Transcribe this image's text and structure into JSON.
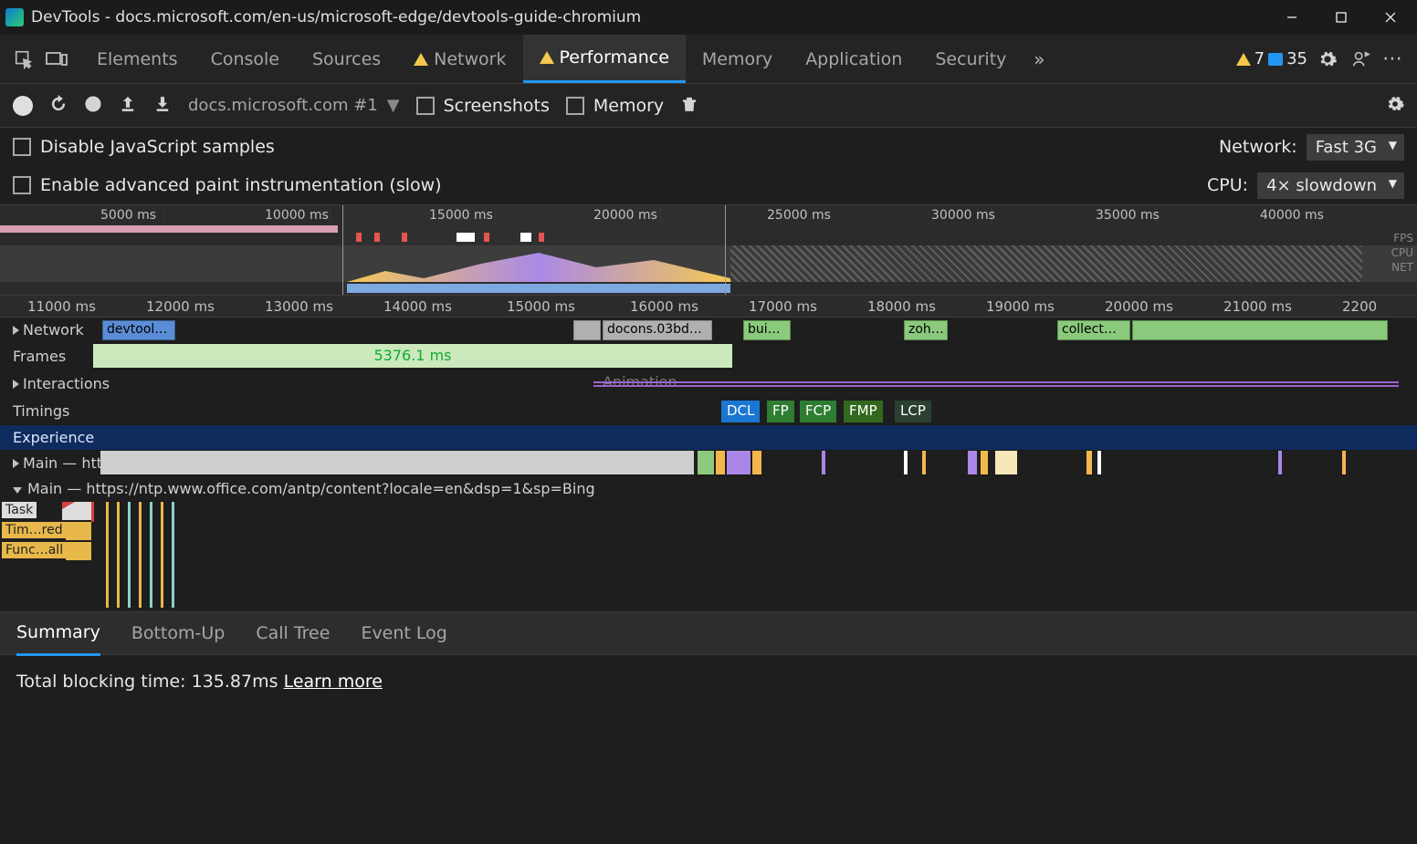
{
  "window": {
    "title": "DevTools - docs.microsoft.com/en-us/microsoft-edge/devtools-guide-chromium"
  },
  "tabs": {
    "items": [
      "Elements",
      "Console",
      "Sources",
      "Network",
      "Performance",
      "Memory",
      "Application",
      "Security"
    ],
    "active": "Performance",
    "warnings": 7,
    "issues": 35
  },
  "perfToolbar": {
    "profile": "docs.microsoft.com #1",
    "screenshotsLabel": "Screenshots",
    "memoryLabel": "Memory"
  },
  "options": {
    "disableJS": "Disable JavaScript samples",
    "enablePaint": "Enable advanced paint instrumentation (slow)",
    "networkLabel": "Network:",
    "networkValue": "Fast 3G",
    "cpuLabel": "CPU:",
    "cpuValue": "4× slowdown"
  },
  "overview": {
    "ticks": [
      "5000 ms",
      "10000 ms",
      "15000 ms",
      "20000 ms",
      "25000 ms",
      "30000 ms",
      "35000 ms",
      "40000 ms"
    ],
    "labels": {
      "fps": "FPS",
      "cpu": "CPU",
      "net": "NET"
    }
  },
  "ruler2": {
    "ticks": [
      "11000 ms",
      "12000 ms",
      "13000 ms",
      "14000 ms",
      "15000 ms",
      "16000 ms",
      "17000 ms",
      "18000 ms",
      "19000 ms",
      "20000 ms",
      "21000 ms",
      "2200"
    ]
  },
  "tracks": {
    "network": "Network",
    "networkItems": {
      "devtool": "devtool…",
      "docons": "docons.03bd…",
      "bui": "bui…",
      "zoh": "zoh…",
      "collect": "collect…"
    },
    "frames": "Frames",
    "frameValue": "5376.1 ms",
    "interactions": "Interactions",
    "animation": "Animation",
    "timings": "Timings",
    "timingChips": {
      "dcl": "DCL",
      "fp": "FP",
      "fcp": "FCP",
      "fmp": "FMP",
      "lcp": "LCP"
    },
    "experience": "Experience",
    "main1": "Main — https://docs.microsoft.com/en-us/microsoft-edge/devtools-guide-chromium",
    "main2": "Main — https://ntp.www.office.com/antp/content?locale=en&dsp=1&sp=Bing",
    "task": "Task",
    "timred": "Tim…red",
    "funcall": "Func…all"
  },
  "bottomTabs": {
    "items": [
      "Summary",
      "Bottom-Up",
      "Call Tree",
      "Event Log"
    ],
    "active": "Summary"
  },
  "summary": {
    "blocking": "Total blocking time: 135.87ms",
    "learn": "Learn more"
  }
}
